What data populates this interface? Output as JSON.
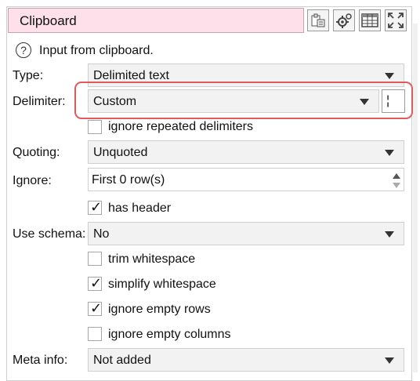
{
  "title": "Clipboard",
  "toolbar": {
    "icons": [
      "paste-icon",
      "gear-icon",
      "table-icon",
      "expand-icon"
    ]
  },
  "info": {
    "icon": "help-circle-icon",
    "text": "Input from clipboard."
  },
  "type": {
    "label": "Type:",
    "value": "Delimited text"
  },
  "delimiter": {
    "label": "Delimiter:",
    "value": "Custom",
    "custom_value": "¦"
  },
  "ignore_repeated": {
    "label": "ignore repeated delimiters",
    "checked": false
  },
  "quoting": {
    "label": "Quoting:",
    "value": "Unquoted"
  },
  "ignore": {
    "label": "Ignore:",
    "value": "First 0 row(s)"
  },
  "has_header": {
    "label": "has header",
    "checked": true
  },
  "schema": {
    "label": "Use schema:",
    "value": "No"
  },
  "trim_ws": {
    "label": "trim whitespace",
    "checked": false
  },
  "simplify_ws": {
    "label": "simplify whitespace",
    "checked": true
  },
  "ignore_empty_rows": {
    "label": "ignore empty rows",
    "checked": true
  },
  "ignore_empty_cols": {
    "label": "ignore empty columns",
    "checked": false
  },
  "meta": {
    "label": "Meta info:",
    "value": "Not added"
  },
  "colors": {
    "title_bg": "#fde0ea",
    "highlight": "#e05a5a",
    "combo_bg": "#f2f2f2"
  }
}
